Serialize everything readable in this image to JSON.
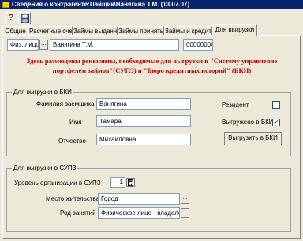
{
  "window": {
    "title": "Сведения о контрагенте:Пайщик\\Ванягина Т.М. (13.07.07)"
  },
  "toolbar": {
    "help_label": "?"
  },
  "tabs": [
    "Общие",
    "Расчетные счета",
    "Займы выданные",
    "Займы принятые",
    "Займы и кредиты",
    "Для выгрузки"
  ],
  "header": {
    "type_value": "Физ. лицо",
    "dots": "...",
    "name_value": "Ванягина Т.М.",
    "code_value": "00000004"
  },
  "info_text": "Здесь размещены реквизиты, необходимые  для выгрузки в \"Систему управление портфелем займов\"(СУПЗ) и \"Бюро кредитных историй\" (БКИ)",
  "bki": {
    "legend": "Для выгрузки в БКИ",
    "surname_label": "Фамилия заемщика",
    "surname_value": "Ванягина",
    "name_label": "Имя",
    "name_value": "Тамара",
    "patronymic_label": "Отчество",
    "patronymic_value": "Михайловна",
    "resident_label": "Резидент",
    "resident_checked": false,
    "exported_label": "Выгружено в БКИ",
    "exported_checked": true,
    "check_mark": "✓",
    "export_button": "Выгрузить в БКИ"
  },
  "supz": {
    "legend": "Для выгрузки в СУПЗ",
    "level_label": "Уровень организации в СУПЗ",
    "level_value": "1",
    "residence_label": "Место жительства",
    "residence_value": "Город",
    "occupation_label": "Род занятий",
    "occupation_value": "Физическое лицо - владелец"
  }
}
